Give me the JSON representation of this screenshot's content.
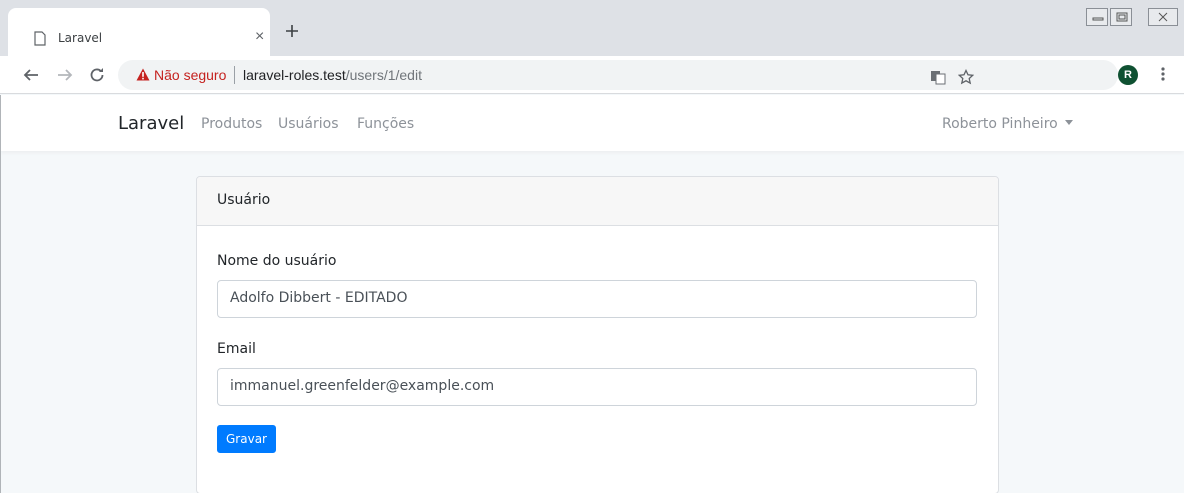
{
  "browser": {
    "tab_title": "Laravel",
    "tab_close": "×",
    "security_label": "Não seguro",
    "url_host": "laravel-roles.test",
    "url_path": "/users/1/edit",
    "profile_initial": "R"
  },
  "navbar": {
    "brand": "Laravel",
    "links": [
      "Produtos",
      "Usuários",
      "Funções"
    ],
    "user_name": "Roberto Pinheiro"
  },
  "card": {
    "header": "Usuário",
    "name_label": "Nome do usuário",
    "name_value": "Adolfo Dibbert - EDITADO",
    "email_label": "Email",
    "email_value": "immanuel.greenfelder@example.com",
    "submit_label": "Gravar"
  },
  "colors": {
    "primary": "#007bff",
    "insecure": "#c5221f",
    "page_bg": "#f5f8fa"
  }
}
